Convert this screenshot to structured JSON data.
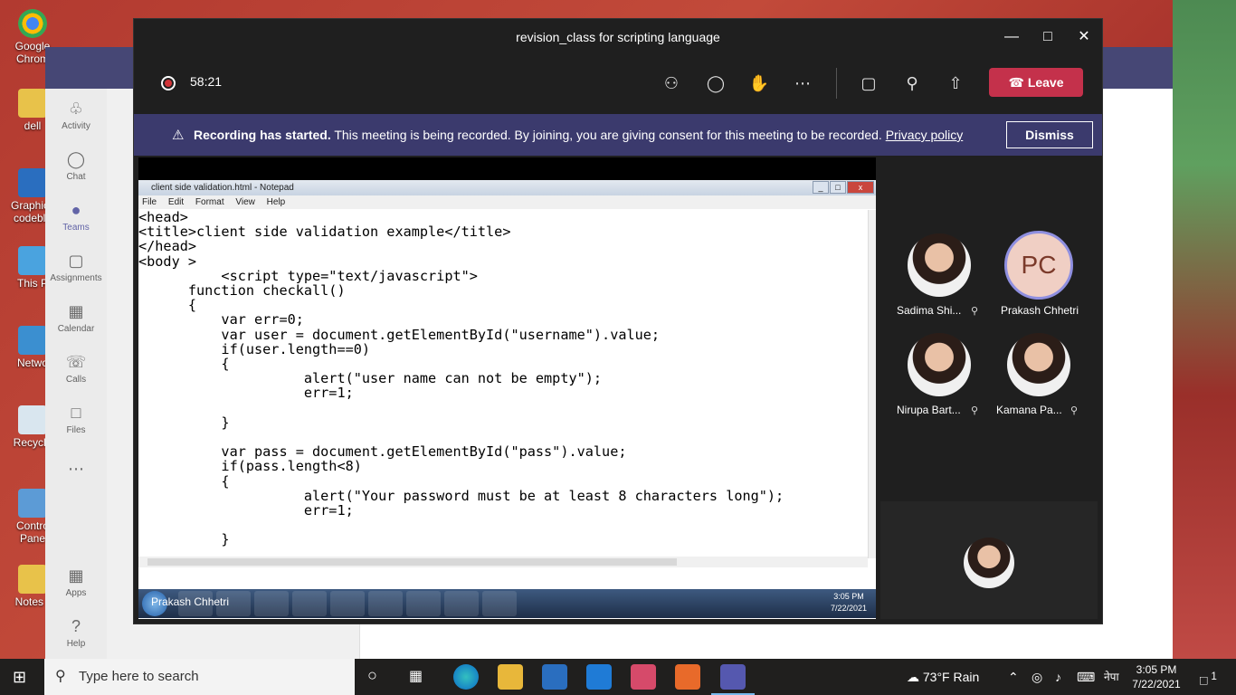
{
  "meeting": {
    "title": "revision_class for scripting language",
    "timer": "58:21",
    "leave_label": "Leave"
  },
  "banner": {
    "bold": "Recording has started.",
    "text": " This meeting is being recorded. By joining, you are giving consent for this meeting to be recorded. ",
    "link": "Privacy policy",
    "dismiss": "Dismiss"
  },
  "notepad": {
    "title": "client side validation.html - Notepad",
    "menu": [
      "File",
      "Edit",
      "Format",
      "View",
      "Help"
    ],
    "code": "<head>\n<title>client side validation example</title>\n</head>\n<body >\n          <script type=\"text/javascript\">\n      function checkall()\n      {\n          var err=0;\n          var user = document.getElementById(\"username\").value;\n          if(user.length==0)\n          {\n                    alert(\"user name can not be empty\");\n                    err=1;\n\n          }\n\n          var pass = document.getElementById(\"pass\").value;\n          if(pass.length<8)\n          {\n                    alert(\"Your password must be at least 8 characters long\");\n                    err=1;\n\n          }",
    "clock_time": "3:05 PM",
    "clock_date": "7/22/2021"
  },
  "presenter": "Prakash Chhetri",
  "participants": [
    {
      "name": "Sadima Shi...",
      "muted": true
    },
    {
      "name": "Prakash Chhetri",
      "initials": "PC",
      "muted": false
    },
    {
      "name": "Nirupa Bart...",
      "muted": true
    },
    {
      "name": "Kamana Pa...",
      "muted": true
    }
  ],
  "teams_rail": [
    {
      "label": "Activity",
      "icon": "bell-icon"
    },
    {
      "label": "Chat",
      "icon": "chat-icon"
    },
    {
      "label": "Teams",
      "icon": "teams-icon"
    },
    {
      "label": "Assignments",
      "icon": "assignments-icon"
    },
    {
      "label": "Calendar",
      "icon": "calendar-icon"
    },
    {
      "label": "Calls",
      "icon": "phone-icon"
    },
    {
      "label": "Files",
      "icon": "file-icon"
    },
    {
      "label": "Apps",
      "icon": "apps-icon"
    },
    {
      "label": "Help",
      "icon": "help-icon"
    }
  ],
  "desktop_icons": [
    "Google Chrom",
    "dell",
    "Graphics codeblo",
    "This P",
    "Netwo",
    "Recycle",
    "Contro Pane",
    "Notes ("
  ],
  "taskbar": {
    "search_placeholder": "Type here to search",
    "weather": "73°F  Rain",
    "lang": "नेपा",
    "time": "3:05 PM",
    "date": "7/22/2021",
    "notifications": "1"
  },
  "colors": {
    "leave": "#c4314b",
    "banner": "#3b3a6d",
    "teams_accent": "#6264a7"
  }
}
